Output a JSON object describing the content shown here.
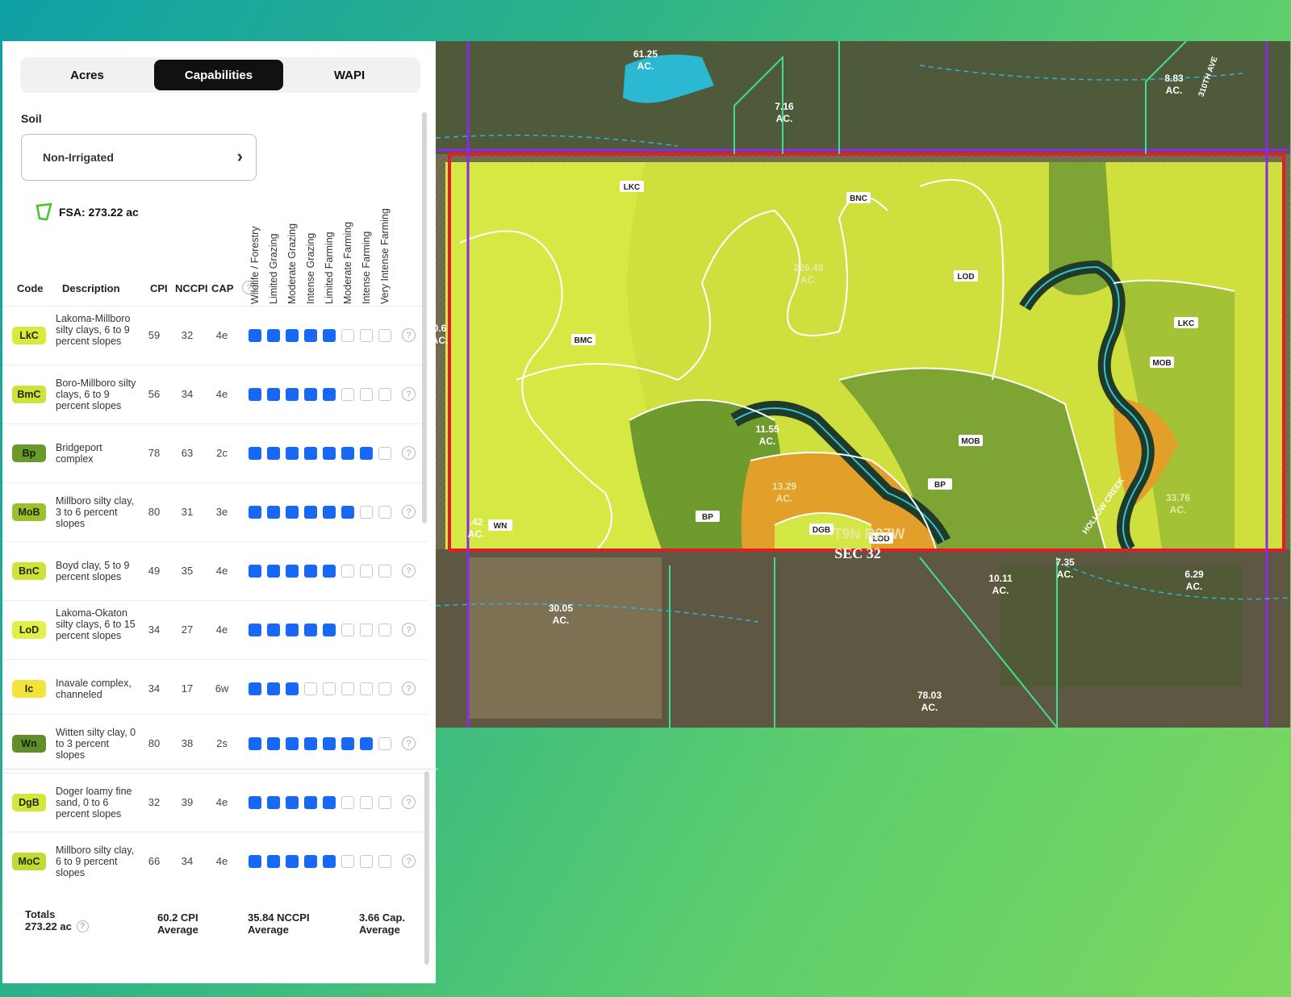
{
  "tabs": [
    {
      "label": "Acres",
      "active": false
    },
    {
      "label": "Capabilities",
      "active": true
    },
    {
      "label": "WAPI",
      "active": false
    }
  ],
  "soil": {
    "label": "Soil",
    "select_value": "Non-Irrigated"
  },
  "fsa": {
    "label": "FSA: 273.22 ac"
  },
  "columns": {
    "code": "Code",
    "description": "Description",
    "cpi": "CPI",
    "nccpi": "NCCPI",
    "cap": "CAP",
    "capability_levels": [
      "Wildlife / Forestry",
      "Limited Grazing",
      "Moderate Grazing",
      "Intense Grazing",
      "Limited Farming",
      "Moderate Farming",
      "Intense Farming",
      "Very Intense Farming"
    ]
  },
  "colors": {
    "accent": "#1769f5",
    "active_tab": "#111111",
    "badge_yellow": "#d8ea3a",
    "badge_green": "#7fa32a"
  },
  "rows": [
    {
      "code": "LkC",
      "desc": "Lakoma-Millboro silty clays, 6 to 9 percent slopes",
      "cpi": "59",
      "nccpi": "32",
      "cap": "4e",
      "level": 5,
      "color": "#d8ea3a"
    },
    {
      "code": "BmC",
      "desc": "Boro-Millboro silty clays, 6 to 9 percent slopes",
      "cpi": "56",
      "nccpi": "34",
      "cap": "4e",
      "level": 5,
      "color": "#cfe23a"
    },
    {
      "code": "Bp",
      "desc": "Bridgeport complex",
      "cpi": "78",
      "nccpi": "63",
      "cap": "2c",
      "level": 7,
      "color": "#6a9a2c"
    },
    {
      "code": "MoB",
      "desc": "Millboro silty clay, 3 to 6 percent slopes",
      "cpi": "80",
      "nccpi": "31",
      "cap": "3e",
      "level": 6,
      "color": "#9bbf2e"
    },
    {
      "code": "BnC",
      "desc": "Boyd clay, 5 to 9 percent slopes",
      "cpi": "49",
      "nccpi": "35",
      "cap": "4e",
      "level": 5,
      "color": "#cfe23a"
    },
    {
      "code": "LoD",
      "desc": "Lakoma-Okaton silty clays, 6 to 15 percent slopes",
      "cpi": "34",
      "nccpi": "27",
      "cap": "4e",
      "level": 5,
      "color": "#e2ee4a"
    },
    {
      "code": "Ic",
      "desc": "Inavale complex, channeled",
      "cpi": "34",
      "nccpi": "17",
      "cap": "6w",
      "level": 3,
      "color": "#f2e43a"
    },
    {
      "code": "Wn",
      "desc": "Witten silty clay, 0 to 3 percent slopes",
      "cpi": "80",
      "nccpi": "38",
      "cap": "2s",
      "level": 7,
      "color": "#5f8f26"
    },
    {
      "code": "DgB",
      "desc": "Doger loamy fine sand, 0 to 6 percent slopes",
      "cpi": "32",
      "nccpi": "39",
      "cap": "4e",
      "level": 5,
      "color": "#d2e63c"
    },
    {
      "code": "MoC",
      "desc": "Millboro silty clay, 6 to 9 percent slopes",
      "cpi": "66",
      "nccpi": "34",
      "cap": "4e",
      "level": 5,
      "color": "#c2da34"
    }
  ],
  "totals": {
    "label": "Totals",
    "acres": "273.22 ac",
    "cpi": "60.2 CPI",
    "cpi_sub": "Average",
    "nccpi": "35.84 NCCPI",
    "nccpi_sub": "Average",
    "cap": "3.66 Cap.",
    "cap_sub": "Average"
  },
  "map": {
    "acre_labels": [
      {
        "value": "61.25",
        "unit": "AC."
      },
      {
        "value": "7.16",
        "unit": "AC."
      },
      {
        "value": "8.83",
        "unit": "AC."
      },
      {
        "value": "226.49",
        "unit": "AC."
      },
      {
        "value": "11.55",
        "unit": "AC."
      },
      {
        "value": "13.29",
        "unit": "AC."
      },
      {
        "value": "33.76",
        "unit": "AC."
      },
      {
        "value": "0.6",
        "unit": "AC."
      },
      {
        "value": ".42",
        "unit": "AC."
      },
      {
        "value": "7.35",
        "unit": "AC."
      },
      {
        "value": "10.11",
        "unit": "AC."
      },
      {
        "value": "6.29",
        "unit": "AC."
      },
      {
        "value": "30.05",
        "unit": "AC."
      },
      {
        "value": "78.03",
        "unit": "AC."
      }
    ],
    "soil_labels": [
      "LKC",
      "BNC",
      "LOD",
      "BMC",
      "LKC",
      "MOB",
      "MOB",
      "BP",
      "BP",
      "DGB",
      "LOD",
      "WN"
    ],
    "road_label": "310TH AVE",
    "creek_label": "HOLLOW CREEK",
    "township_label": "T9N R27W",
    "section_label": "SEC 32"
  }
}
